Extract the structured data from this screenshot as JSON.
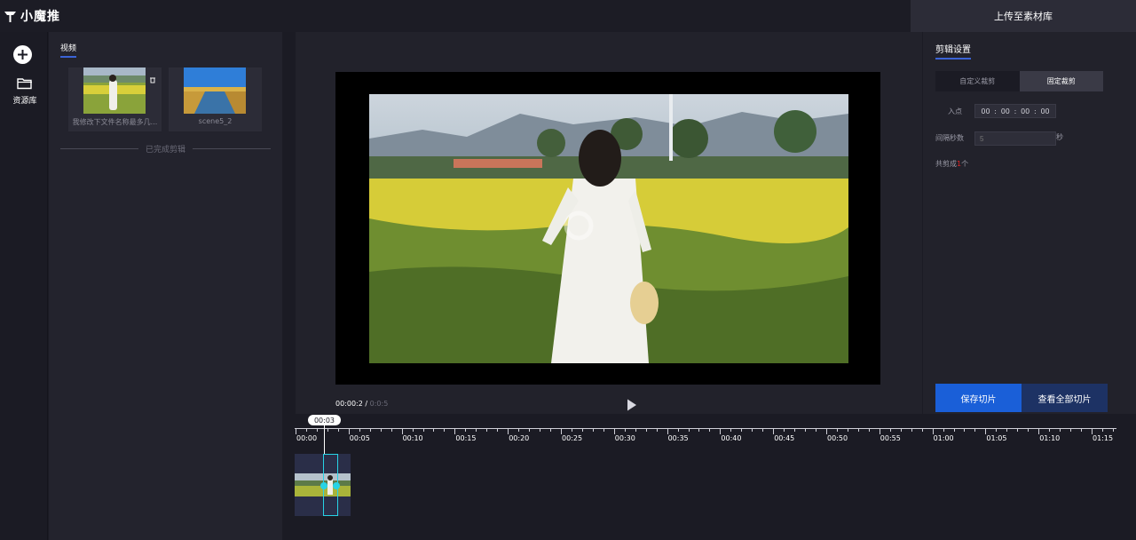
{
  "app": {
    "logo_text": "小魔推"
  },
  "topbar": {
    "upload_label": "上传至素材库"
  },
  "rail": {
    "library_label": "资源库"
  },
  "resources": {
    "tab_label": "视频",
    "items": [
      {
        "name": "我修改下文件名称最多几..."
      },
      {
        "name": "scene5_2"
      }
    ],
    "divider_label": "已完成剪辑"
  },
  "player": {
    "current_time": "00:00:2",
    "separator": " / ",
    "total_time": "0:0:5"
  },
  "timeline": {
    "playhead_time": "00:03",
    "ticks": [
      "00:00",
      "00:05",
      "00:10",
      "00:15",
      "00:20",
      "00:25",
      "00:30",
      "00:35",
      "00:40",
      "00:45",
      "00:50",
      "00:55",
      "01:00",
      "01:05",
      "01:10",
      "01:15"
    ]
  },
  "settings": {
    "title": "剪辑设置",
    "modes": [
      "自定义裁剪",
      "固定裁剪"
    ],
    "selected_mode": "固定裁剪",
    "in_point_label": "入点",
    "in_point_value": [
      "00",
      "00",
      "00",
      "00"
    ],
    "interval_label": "间隔秒数",
    "interval_placeholder": "5",
    "interval_unit": "秒",
    "count_prefix": "共剪成",
    "count_value": "1",
    "count_suffix": "个"
  },
  "actions": {
    "save_label": "保存切片",
    "view_label": "查看全部切片"
  },
  "colors": {
    "accent": "#1a5fd8",
    "selection": "#27d3e6",
    "danger": "#e02424"
  }
}
